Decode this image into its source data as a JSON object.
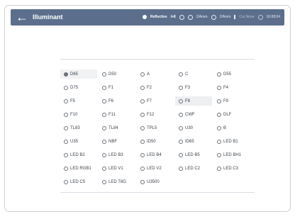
{
  "header": {
    "back_glyph": "←",
    "title": "Illuminant",
    "status": {
      "mode": "Reflective",
      "mode_icon": "dot-icon",
      "aperture": "I+8",
      "sensor_icon": "sensor-icon",
      "observer1": "2/Amm",
      "observer2": "2/Amm",
      "bar_icon": "bar-icon",
      "filter": "Cut None",
      "time": "16:08:04"
    }
  },
  "illuminants": [
    {
      "label": "D65",
      "selected": true
    },
    {
      "label": "D50"
    },
    {
      "label": "A"
    },
    {
      "label": "C"
    },
    {
      "label": "D55"
    },
    {
      "label": "D75"
    },
    {
      "label": "F1"
    },
    {
      "label": "F2"
    },
    {
      "label": "F3"
    },
    {
      "label": "F4"
    },
    {
      "label": "F5"
    },
    {
      "label": "F6"
    },
    {
      "label": "F7"
    },
    {
      "label": "F8",
      "highlighted": true
    },
    {
      "label": "F9"
    },
    {
      "label": "F10"
    },
    {
      "label": "F11"
    },
    {
      "label": "F12"
    },
    {
      "label": "CWF"
    },
    {
      "label": "DLF"
    },
    {
      "label": "TL83"
    },
    {
      "label": "TL84"
    },
    {
      "label": "TPL5"
    },
    {
      "label": "U30"
    },
    {
      "label": "B"
    },
    {
      "label": "U35"
    },
    {
      "label": "NBF"
    },
    {
      "label": "ID50"
    },
    {
      "label": "ID65"
    },
    {
      "label": "LED B1"
    },
    {
      "label": "LED B2"
    },
    {
      "label": "LED B3"
    },
    {
      "label": "LED B4"
    },
    {
      "label": "LED B5"
    },
    {
      "label": "LED BH1"
    },
    {
      "label": "LED RGB1"
    },
    {
      "label": "LED V1"
    },
    {
      "label": "LED V2"
    },
    {
      "label": "LED C2"
    },
    {
      "label": "LED C3"
    },
    {
      "label": "LED C5"
    },
    {
      "label": "LED T8G"
    },
    {
      "label": "U3500"
    }
  ],
  "colors": {
    "titlebar": "#5b6f8c",
    "selected_row": "#f1f2f4"
  }
}
